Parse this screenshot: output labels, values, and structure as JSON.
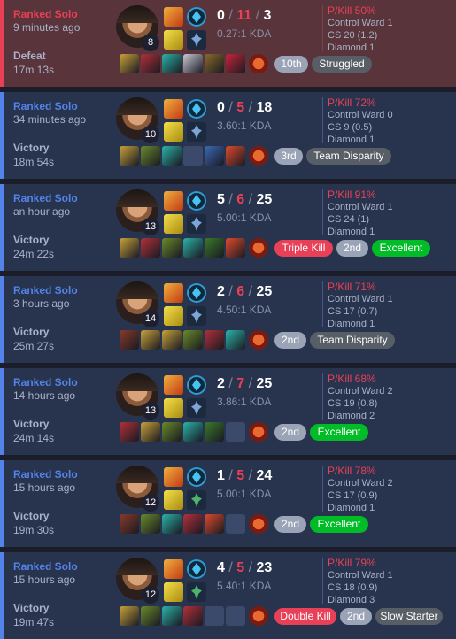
{
  "matches": [
    {
      "queue": "Ranked Solo",
      "ago": "9 minutes ago",
      "result": "Defeat",
      "duration": "17m 13s",
      "level": "8",
      "kills": "0",
      "deaths": "11",
      "assists": "3",
      "kda": "0.27:1 KDA",
      "pkill": "P/Kill 50%",
      "wards": "Control Ward 1",
      "cs": "CS 20 (1.2)",
      "rank": "Diamond 1",
      "defeat": true,
      "secondary_rune": "blue",
      "items": [
        "#c9a23a",
        "#b3303a",
        "#2bb3a8",
        "#c7c9d3",
        "#8a6a2a",
        "#c8243a",
        ""
      ],
      "badges": [
        {
          "text": "10th",
          "style": "gray"
        },
        {
          "text": "Struggled",
          "style": "dark"
        }
      ]
    },
    {
      "queue": "Ranked Solo",
      "ago": "34 minutes ago",
      "result": "Victory",
      "duration": "18m 54s",
      "level": "10",
      "kills": "0",
      "deaths": "5",
      "assists": "18",
      "kda": "3.60:1 KDA",
      "pkill": "P/Kill 72%",
      "wards": "Control Ward 0",
      "cs": "CS 9 (0.5)",
      "rank": "Diamond 1",
      "defeat": false,
      "secondary_rune": "blue",
      "items": [
        "#c9a23a",
        "#6a8a2a",
        "#2bb3a8",
        "empty",
        "#3a6ab8",
        "#e04a2a",
        ""
      ],
      "badges": [
        {
          "text": "3rd",
          "style": "gray"
        },
        {
          "text": "Team Disparity",
          "style": "dark"
        }
      ]
    },
    {
      "queue": "Ranked Solo",
      "ago": "an hour ago",
      "result": "Victory",
      "duration": "24m 22s",
      "level": "13",
      "kills": "5",
      "deaths": "6",
      "assists": "25",
      "kda": "5.00:1 KDA",
      "pkill": "P/Kill 91%",
      "wards": "Control Ward 1",
      "cs": "CS 24 (1)",
      "rank": "Diamond 1",
      "defeat": false,
      "secondary_rune": "blue",
      "items": [
        "#c9a23a",
        "#b3303a",
        "#6a8a2a",
        "#2bb3a8",
        "#3a7a2a",
        "#e04a2a",
        ""
      ],
      "badges": [
        {
          "text": "Triple Kill",
          "style": "red"
        },
        {
          "text": "2nd",
          "style": "gray"
        },
        {
          "text": "Excellent",
          "style": "green"
        }
      ]
    },
    {
      "queue": "Ranked Solo",
      "ago": "3 hours ago",
      "result": "Victory",
      "duration": "25m 27s",
      "level": "14",
      "kills": "2",
      "deaths": "6",
      "assists": "25",
      "kda": "4.50:1 KDA",
      "pkill": "P/Kill 71%",
      "wards": "Control Ward 1",
      "cs": "CS 17 (0.7)",
      "rank": "Diamond 1",
      "defeat": false,
      "secondary_rune": "blue",
      "items": [
        "#8a3a2a",
        "#c9a23a",
        "#c9a23a",
        "#6a8a2a",
        "#b3303a",
        "#2bb3a8",
        ""
      ],
      "badges": [
        {
          "text": "2nd",
          "style": "gray"
        },
        {
          "text": "Team Disparity",
          "style": "dark"
        }
      ]
    },
    {
      "queue": "Ranked Solo",
      "ago": "14 hours ago",
      "result": "Victory",
      "duration": "24m 14s",
      "level": "13",
      "kills": "2",
      "deaths": "7",
      "assists": "25",
      "kda": "3.86:1 KDA",
      "pkill": "P/Kill 68%",
      "wards": "Control Ward 2",
      "cs": "CS 19 (0.8)",
      "rank": "Diamond 2",
      "defeat": false,
      "secondary_rune": "blue",
      "items": [
        "#b3303a",
        "#c9a23a",
        "#6a8a2a",
        "#2bb3a8",
        "#3a7a2a",
        "empty",
        ""
      ],
      "badges": [
        {
          "text": "2nd",
          "style": "gray"
        },
        {
          "text": "Excellent",
          "style": "green"
        }
      ]
    },
    {
      "queue": "Ranked Solo",
      "ago": "15 hours ago",
      "result": "Victory",
      "duration": "19m 30s",
      "level": "12",
      "kills": "1",
      "deaths": "5",
      "assists": "24",
      "kda": "5.00:1 KDA",
      "pkill": "P/Kill 78%",
      "wards": "Control Ward 2",
      "cs": "CS 17 (0.9)",
      "rank": "Diamond 1",
      "defeat": false,
      "secondary_rune": "green",
      "items": [
        "#8a3a2a",
        "#6a8a2a",
        "#2bb3a8",
        "#b3303a",
        "#e04a2a",
        "empty",
        ""
      ],
      "badges": [
        {
          "text": "2nd",
          "style": "gray"
        },
        {
          "text": "Excellent",
          "style": "green"
        }
      ]
    },
    {
      "queue": "Ranked Solo",
      "ago": "15 hours ago",
      "result": "Victory",
      "duration": "19m 47s",
      "level": "12",
      "kills": "4",
      "deaths": "5",
      "assists": "23",
      "kda": "5.40:1 KDA",
      "pkill": "P/Kill 79%",
      "wards": "Control Ward 1",
      "cs": "CS 18 (0.9)",
      "rank": "Diamond 3",
      "defeat": false,
      "secondary_rune": "green",
      "items": [
        "#c9a23a",
        "#6a8a2a",
        "#2bb3a8",
        "#b3303a",
        "empty",
        "empty",
        ""
      ],
      "badges": [
        {
          "text": "Double Kill",
          "style": "red"
        },
        {
          "text": "2nd",
          "style": "gray"
        },
        {
          "text": "Slow Starter",
          "style": "dark"
        }
      ]
    }
  ],
  "colors": {
    "accent_blue": "#5383e8",
    "accent_red": "#e84057",
    "win_bg": "#28344e",
    "loss_bg": "#59343b"
  }
}
